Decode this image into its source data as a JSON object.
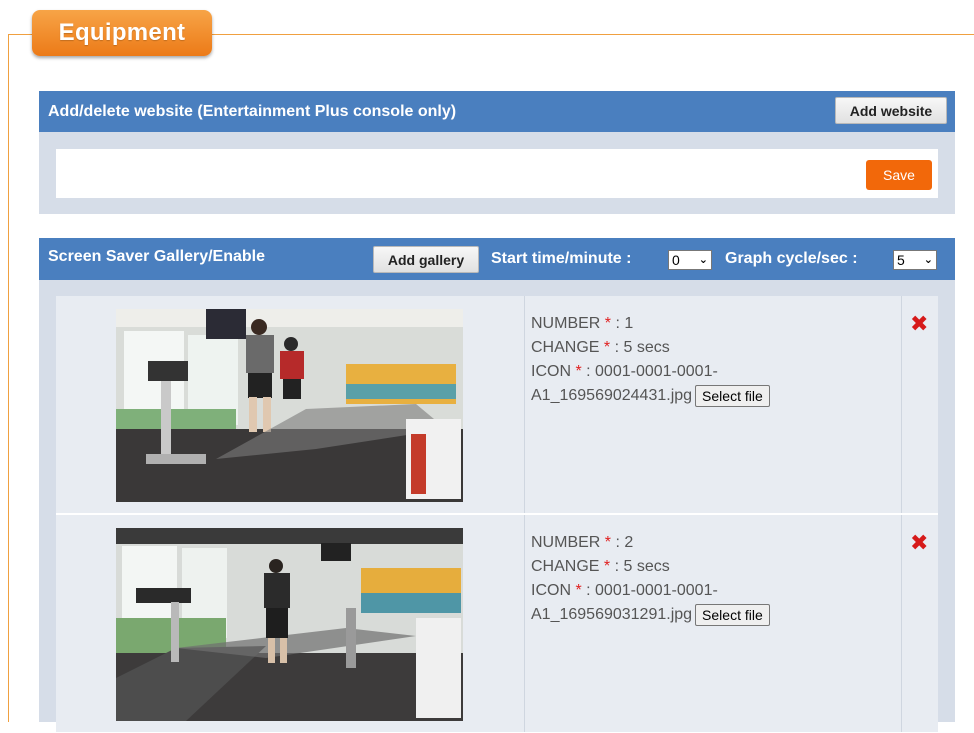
{
  "section_title": "Equipment",
  "website_panel": {
    "title": "Add/delete website (Entertainment Plus console only)",
    "add_button": "Add website",
    "save_button": "Save"
  },
  "gallery_panel": {
    "title": "Screen Saver Gallery/Enable",
    "add_button": "Add gallery",
    "start_label": "Start time/minute :",
    "start_value": "0",
    "graph_label": "Graph cycle/sec :",
    "graph_value": "5",
    "items": [
      {
        "number_label": "NUMBER",
        "number": "1",
        "change_label": "CHANGE",
        "change": "5 secs",
        "icon_label": "ICON",
        "icon_file_line1": "0001-0001-0001-",
        "icon_file_line2": "A1_169569024431.jpg",
        "select_file": "Select file"
      },
      {
        "number_label": "NUMBER",
        "number": "2",
        "change_label": "CHANGE",
        "change": "5 secs",
        "icon_label": "ICON",
        "icon_file_line1": "0001-0001-0001-",
        "icon_file_line2": "A1_169569031291.jpg",
        "select_file": "Select file"
      }
    ]
  },
  "icons": {
    "delete": "close-icon",
    "dropdown": "chevron-down-icon"
  },
  "colors": {
    "accent_orange": "#ec7a17",
    "header_blue": "#4a7fbf",
    "save_orange": "#f2680a",
    "delete_red": "#d61a1a"
  }
}
